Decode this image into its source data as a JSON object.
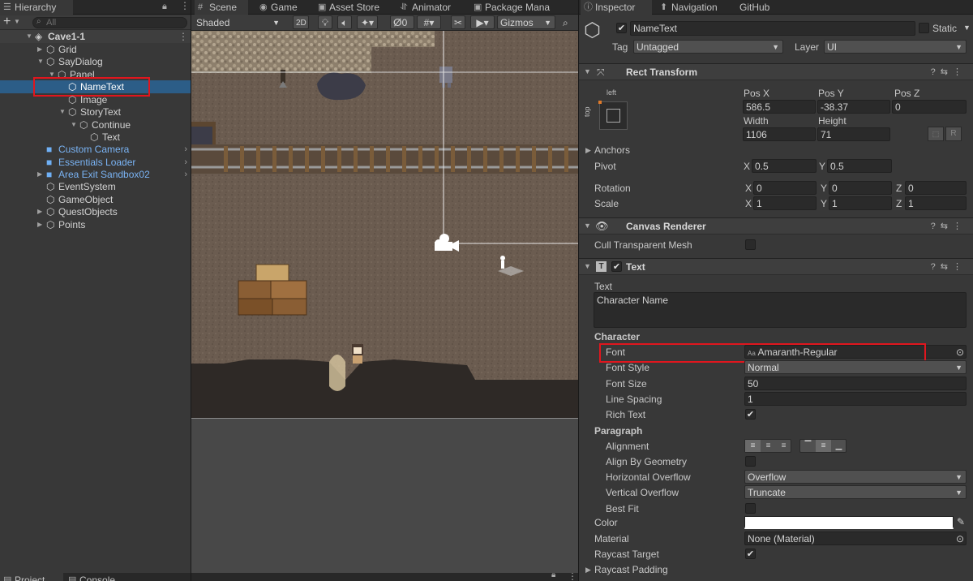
{
  "hierarchy": {
    "tab": "Hierarchy",
    "search_placeholder": "All",
    "add_label": "+",
    "scene_name": "Cave1-1",
    "items": [
      {
        "label": "Grid"
      },
      {
        "label": "SayDialog"
      },
      {
        "label": "Panel"
      },
      {
        "label": "NameText"
      },
      {
        "label": "Image"
      },
      {
        "label": "StoryText"
      },
      {
        "label": "Continue"
      },
      {
        "label": "Text"
      },
      {
        "label": "Custom Camera"
      },
      {
        "label": "Essentials Loader"
      },
      {
        "label": "Area Exit Sandbox02"
      },
      {
        "label": "EventSystem"
      },
      {
        "label": "GameObject"
      },
      {
        "label": "QuestObjects"
      },
      {
        "label": "Points"
      }
    ]
  },
  "scene_tabs": [
    "Scene",
    "Game",
    "Asset Store",
    "Animator",
    "Package Mana"
  ],
  "scene_toolbar": {
    "shading": "Shaded",
    "mode_2d": "2D",
    "hidden_count": "0",
    "gizmos": "Gizmos"
  },
  "bottom_tabs": [
    "Project",
    "Console"
  ],
  "inspector": {
    "tabs": [
      "Inspector",
      "Navigation",
      "GitHub"
    ],
    "object_name": "NameText",
    "static_label": "Static",
    "tag_label": "Tag",
    "tag_value": "Untagged",
    "layer_label": "Layer",
    "layer_value": "UI",
    "rect_transform": {
      "title": "Rect Transform",
      "anchor_h": "left",
      "anchor_v": "top",
      "pos_x_label": "Pos X",
      "pos_x": "586.5",
      "pos_y_label": "Pos Y",
      "pos_y": "-38.37",
      "pos_z_label": "Pos Z",
      "pos_z": "0",
      "width_label": "Width",
      "width": "1106",
      "height_label": "Height",
      "height": "71",
      "r_button": "R",
      "anchors_label": "Anchors",
      "pivot_label": "Pivot",
      "pivot_x": "0.5",
      "pivot_y": "0.5",
      "rotation_label": "Rotation",
      "rot_x": "0",
      "rot_y": "0",
      "rot_z": "0",
      "scale_label": "Scale",
      "scale_x": "1",
      "scale_y": "1",
      "scale_z": "1",
      "axis_x": "X",
      "axis_y": "Y",
      "axis_z": "Z"
    },
    "canvas_renderer": {
      "title": "Canvas Renderer",
      "cull_label": "Cull Transparent Mesh"
    },
    "text_component": {
      "title": "Text",
      "text_label": "Text",
      "text_value": "Character Name",
      "character_header": "Character",
      "font_label": "Font",
      "font_value": "Amaranth-Regular",
      "font_prefix": "Aa",
      "font_style_label": "Font Style",
      "font_style_value": "Normal",
      "font_size_label": "Font Size",
      "font_size_value": "50",
      "line_spacing_label": "Line Spacing",
      "line_spacing_value": "1",
      "rich_text_label": "Rich Text",
      "paragraph_header": "Paragraph",
      "alignment_label": "Alignment",
      "align_by_geometry_label": "Align By Geometry",
      "h_overflow_label": "Horizontal Overflow",
      "h_overflow_value": "Overflow",
      "v_overflow_label": "Vertical Overflow",
      "v_overflow_value": "Truncate",
      "best_fit_label": "Best Fit",
      "color_label": "Color",
      "material_label": "Material",
      "material_value": "None (Material)",
      "raycast_target_label": "Raycast Target",
      "raycast_padding_label": "Raycast Padding"
    }
  },
  "colors": {
    "highlight": "#e0161e",
    "selection": "#2c5d87",
    "prefab_blue": "#7ab4f5"
  }
}
